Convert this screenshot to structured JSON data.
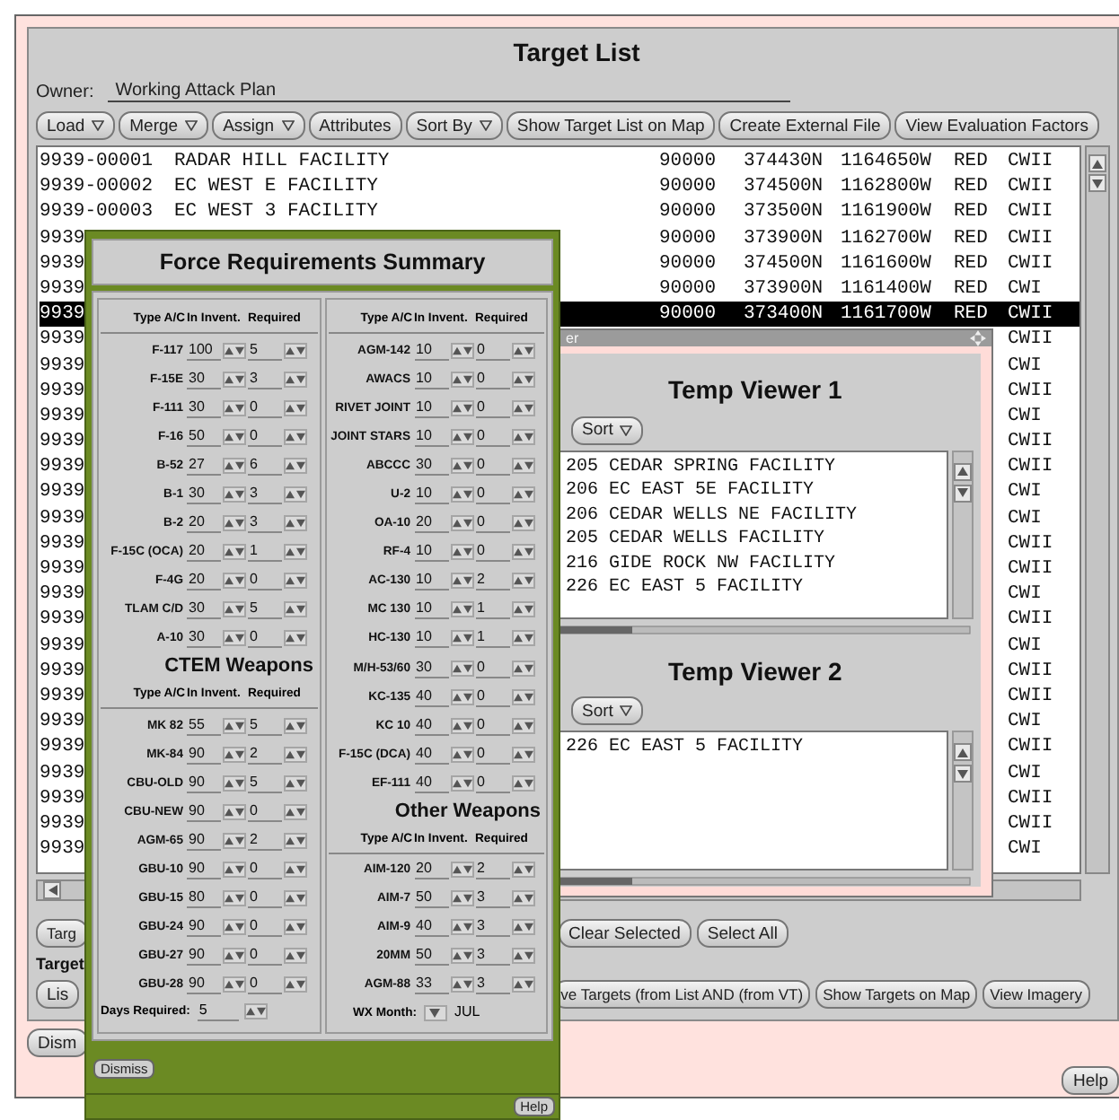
{
  "target_list": {
    "title": "Target List",
    "owner_label": "Owner:",
    "owner": "Working Attack Plan",
    "toolbar": [
      {
        "label": "Load",
        "menu": true
      },
      {
        "label": "Merge",
        "menu": true
      },
      {
        "label": "Assign",
        "menu": true
      },
      {
        "label": "Attributes",
        "menu": false
      },
      {
        "label": "Sort By",
        "menu": true
      },
      {
        "label": "Show Target List on Map",
        "menu": false
      },
      {
        "label": "Create External File",
        "menu": false
      },
      {
        "label": "View Evaluation Factors",
        "menu": false
      }
    ],
    "rows": [
      {
        "id": "9939-00001",
        "name": "RADAR HILL FACILITY",
        "elevation": "90000",
        "lat": "374430N",
        "lon": "1164650W",
        "side": "RED",
        "category": "CWII",
        "selected": false
      },
      {
        "id": "9939-00002",
        "name": "EC WEST E FACILITY",
        "elevation": "90000",
        "lat": "374500N",
        "lon": "1162800W",
        "side": "RED",
        "category": "CWII",
        "selected": false
      },
      {
        "id": "9939-00003",
        "name": "EC WEST 3 FACILITY",
        "elevation": "90000",
        "lat": "373500N",
        "lon": "1161900W",
        "side": "RED",
        "category": "CWII",
        "selected": false
      },
      {
        "id": "9939",
        "elevation": "90000",
        "lat": "373900N",
        "lon": "1162700W",
        "side": "RED",
        "category": "CWII",
        "selected": false
      },
      {
        "id": "9939",
        "elevation": "90000",
        "lat": "374500N",
        "lon": "1161600W",
        "side": "RED",
        "category": "CWII",
        "selected": false
      },
      {
        "id": "9939",
        "elevation": "90000",
        "lat": "373900N",
        "lon": "1161400W",
        "side": "RED",
        "category": "CWI",
        "selected": false
      },
      {
        "id": "9939",
        "elevation": "90000",
        "lat": "373400N",
        "lon": "1161700W",
        "side": "RED",
        "category": "CWII",
        "selected": true
      },
      {
        "id": "9939",
        "category": "CWII",
        "selected": false
      },
      {
        "id": "9939",
        "category": "CWI",
        "selected": false
      },
      {
        "id": "9939",
        "category": "CWII",
        "selected": false
      },
      {
        "id": "9939",
        "category": "CWI",
        "selected": false
      },
      {
        "id": "9939",
        "category": "CWII",
        "selected": false
      },
      {
        "id": "9939",
        "category": "CWII",
        "selected": false
      },
      {
        "id": "9939",
        "category": "CWI",
        "selected": false
      },
      {
        "id": "9939",
        "category": "CWI",
        "selected": false
      },
      {
        "id": "9939",
        "category": "CWII",
        "selected": false
      },
      {
        "id": "9939",
        "category": "CWII",
        "selected": false
      },
      {
        "id": "9939",
        "category": "CWI",
        "selected": false
      },
      {
        "id": "9939",
        "category": "CWII",
        "selected": false
      },
      {
        "id": "9939",
        "category": "CWI",
        "selected": false
      },
      {
        "id": "9939",
        "category": "CWII",
        "selected": false
      },
      {
        "id": "9939",
        "category": "CWII",
        "selected": false
      },
      {
        "id": "9939",
        "category": "CWI",
        "selected": false
      },
      {
        "id": "9939",
        "category": "CWII",
        "selected": false
      },
      {
        "id": "9939",
        "category": "CWI",
        "selected": false
      },
      {
        "id": "9939",
        "category": "CWII",
        "selected": false
      },
      {
        "id": "9939",
        "category": "CWII",
        "selected": false
      },
      {
        "id": "9939",
        "category": "CWI",
        "selected": false
      }
    ],
    "selection_buttons": [
      "Targ",
      "Clear Selected",
      "Select All"
    ],
    "section_label": "Target",
    "action_buttons": [
      "Lis",
      "ve Targets (from List AND (from VT)",
      "Show Targets on Map",
      "View Imagery"
    ],
    "dismiss": "Dism",
    "help": "Help"
  },
  "force_summary": {
    "title": "Force Requirements Summary",
    "left_sections": [
      {
        "header": {
          "type": "Type A/C",
          "invent": "In Invent.",
          "required": "Required"
        },
        "rows": [
          {
            "type": "F-117",
            "invent": "100",
            "required": "5"
          },
          {
            "type": "F-15E",
            "invent": "30",
            "required": "3"
          },
          {
            "type": "F-111",
            "invent": "30",
            "required": "0"
          },
          {
            "type": "F-16",
            "invent": "50",
            "required": "0"
          },
          {
            "type": "B-52",
            "invent": "27",
            "required": "6"
          },
          {
            "type": "B-1",
            "invent": "30",
            "required": "3"
          },
          {
            "type": "B-2",
            "invent": "20",
            "required": "3"
          },
          {
            "type": "F-15C (OCA)",
            "invent": "20",
            "required": "1"
          },
          {
            "type": "F-4G",
            "invent": "20",
            "required": "0"
          },
          {
            "type": "TLAM C/D",
            "invent": "30",
            "required": "5"
          },
          {
            "type": "A-10",
            "invent": "30",
            "required": "0"
          }
        ]
      },
      {
        "heading": "CTEM Weapons",
        "header": {
          "type": "Type A/C",
          "invent": "In Invent.",
          "required": "Required"
        },
        "rows": [
          {
            "type": "MK 82",
            "invent": "55",
            "required": "5"
          },
          {
            "type": "MK-84",
            "invent": "90",
            "required": "2"
          },
          {
            "type": "CBU-OLD",
            "invent": "90",
            "required": "5"
          },
          {
            "type": "CBU-NEW",
            "invent": "90",
            "required": "0"
          },
          {
            "type": "AGM-65",
            "invent": "90",
            "required": "2"
          },
          {
            "type": "GBU-10",
            "invent": "90",
            "required": "0"
          },
          {
            "type": "GBU-15",
            "invent": "80",
            "required": "0"
          },
          {
            "type": "GBU-24",
            "invent": "90",
            "required": "0"
          },
          {
            "type": "GBU-27",
            "invent": "90",
            "required": "0"
          },
          {
            "type": "GBU-28",
            "invent": "90",
            "required": "0"
          }
        ]
      }
    ],
    "right_sections": [
      {
        "header": {
          "type": "Type A/C",
          "invent": "In Invent.",
          "required": "Required"
        },
        "rows": [
          {
            "type": "AGM-142",
            "invent": "10",
            "required": "0"
          },
          {
            "type": "AWACS",
            "invent": "10",
            "required": "0"
          },
          {
            "type": "RIVET JOINT",
            "invent": "10",
            "required": "0"
          },
          {
            "type": "JOINT STARS",
            "invent": "10",
            "required": "0"
          },
          {
            "type": "ABCCC",
            "invent": "30",
            "required": "0"
          },
          {
            "type": "U-2",
            "invent": "10",
            "required": "0"
          },
          {
            "type": "OA-10",
            "invent": "20",
            "required": "0"
          },
          {
            "type": "RF-4",
            "invent": "10",
            "required": "0"
          },
          {
            "type": "AC-130",
            "invent": "10",
            "required": "2"
          },
          {
            "type": "MC 130",
            "invent": "10",
            "required": "1"
          },
          {
            "type": "HC-130",
            "invent": "10",
            "required": "1"
          },
          {
            "type": "M/H-53/60",
            "invent": "30",
            "required": "0"
          },
          {
            "type": "KC-135",
            "invent": "40",
            "required": "0"
          },
          {
            "type": "KC 10",
            "invent": "40",
            "required": "0"
          },
          {
            "type": "F-15C (DCA)",
            "invent": "40",
            "required": "0"
          },
          {
            "type": "EF-111",
            "invent": "40",
            "required": "0"
          }
        ]
      },
      {
        "heading": "Other Weapons",
        "header": {
          "type": "Type A/C",
          "invent": "In Invent.",
          "required": "Required"
        },
        "rows": [
          {
            "type": "AIM-120",
            "invent": "20",
            "required": "2"
          },
          {
            "type": "AIM-7",
            "invent": "50",
            "required": "3"
          },
          {
            "type": "AIM-9",
            "invent": "40",
            "required": "3"
          },
          {
            "type": "20MM",
            "invent": "50",
            "required": "3"
          },
          {
            "type": "AGM-88",
            "invent": "33",
            "required": "3"
          }
        ]
      }
    ],
    "days_label": "Days Required:",
    "days": "5",
    "month_label": "WX Month:",
    "month": "JUL",
    "dismiss": "Dismiss",
    "help": "Help"
  },
  "temp_viewer": {
    "title_fragment": "er",
    "viewers": [
      {
        "title": "Temp Viewer 1",
        "sort": "Sort",
        "items": [
          "205 CEDAR SPRING FACILITY",
          "206 EC EAST 5E FACILITY",
          "206 CEDAR WELLS NE FACILITY",
          "205 CEDAR WELLS FACILITY",
          "216 GIDE ROCK NW FACILITY",
          "226 EC EAST 5 FACILITY"
        ]
      },
      {
        "title": "Temp Viewer 2",
        "sort": "Sort",
        "items": [
          "226 EC EAST 5 FACILITY"
        ]
      }
    ]
  }
}
